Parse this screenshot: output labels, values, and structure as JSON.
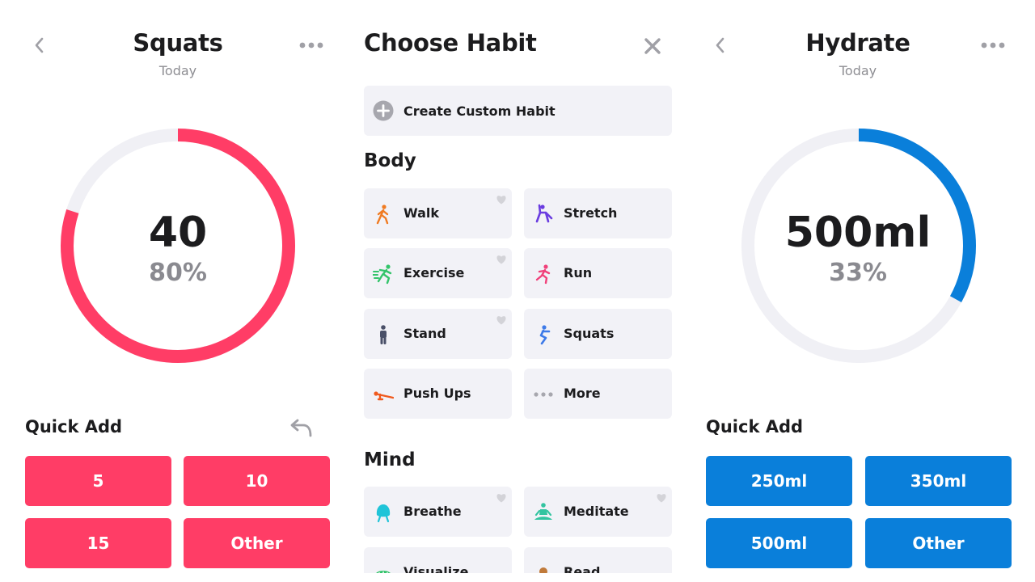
{
  "left_panel": {
    "title": "Squats",
    "subtitle": "Today",
    "value": "40",
    "percent_label": "80%",
    "progress": 0.8,
    "accent": "#ff3d66",
    "quick_add_title": "Quick Add",
    "buttons": [
      "5",
      "10",
      "15",
      "Other"
    ]
  },
  "chooser": {
    "title": "Choose Habit",
    "create_label": "Create Custom Habit",
    "body_title": "Body",
    "mind_title": "Mind",
    "body_items": [
      {
        "label": "Walk",
        "icon": "walk-icon",
        "color": "#f07b22",
        "heart": true
      },
      {
        "label": "Stretch",
        "icon": "stretch-icon",
        "color": "#6a3ce0",
        "heart": false
      },
      {
        "label": "Exercise",
        "icon": "exercise-icon",
        "color": "#33c46a",
        "heart": true
      },
      {
        "label": "Run",
        "icon": "run-icon",
        "color": "#f0407a",
        "heart": false
      },
      {
        "label": "Stand",
        "icon": "stand-icon",
        "color": "#4a5068",
        "heart": true
      },
      {
        "label": "Squats",
        "icon": "squats-icon",
        "color": "#3d7ae8",
        "heart": false
      },
      {
        "label": "Push Ups",
        "icon": "push-ups-icon",
        "color": "#f05a1e",
        "heart": false
      },
      {
        "label": "More",
        "icon": "more-dots-icon",
        "color": "#a7a7ae",
        "heart": false
      }
    ],
    "mind_items": [
      {
        "label": "Breathe",
        "icon": "breathe-icon",
        "color": "#20c4d8",
        "heart": true
      },
      {
        "label": "Meditate",
        "icon": "meditate-icon",
        "color": "#33c4a0",
        "heart": true
      },
      {
        "label": "Visualize",
        "icon": "visualize-icon",
        "color": "#33c46a",
        "heart": false
      },
      {
        "label": "Read",
        "icon": "read-icon",
        "color": "#c07a3a",
        "heart": false
      }
    ]
  },
  "right_panel": {
    "title": "Hydrate",
    "subtitle": "Today",
    "value": "500ml",
    "percent_label": "33%",
    "progress": 0.33,
    "accent": "#0a7fda",
    "quick_add_title": "Quick Add",
    "buttons": [
      "250ml",
      "350ml",
      "500ml",
      "Other"
    ]
  }
}
